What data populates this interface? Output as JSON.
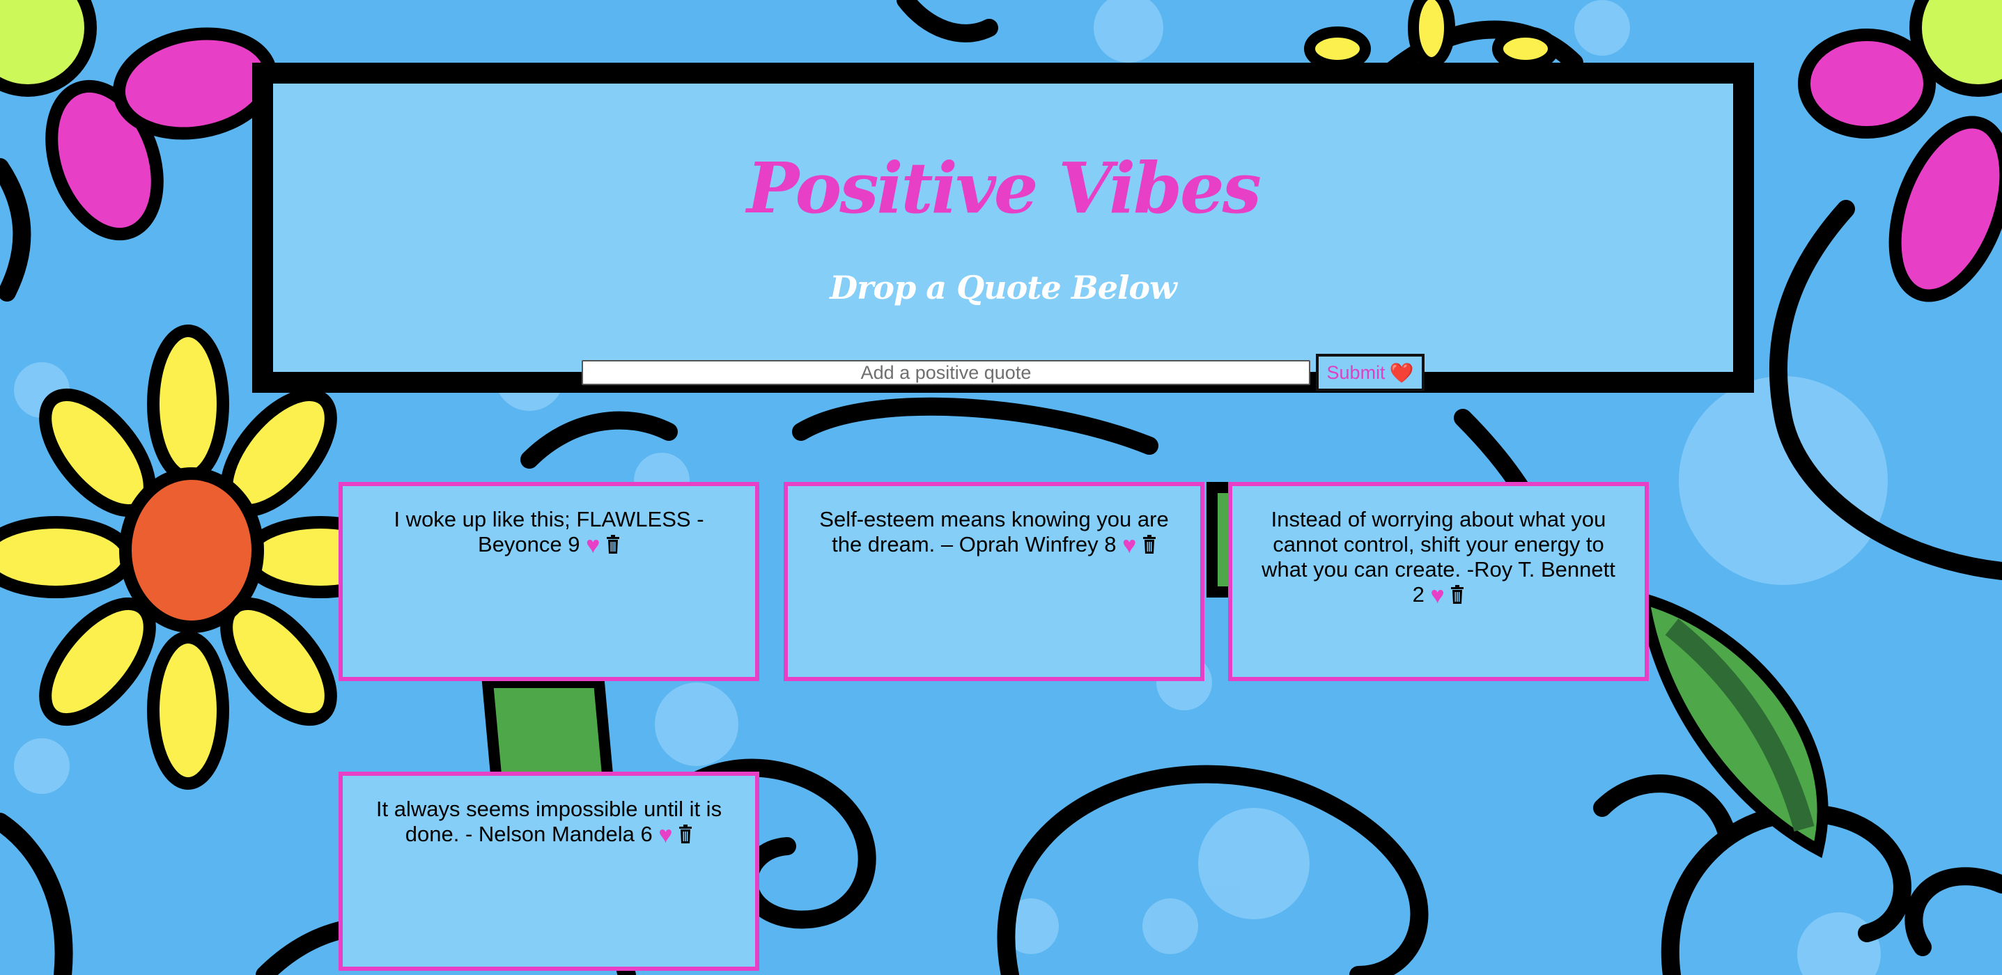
{
  "header": {
    "title": "Positive Vibes",
    "subtitle": "Drop a Quote Below"
  },
  "form": {
    "placeholder": "Add a positive quote",
    "value": "",
    "submit_label": "Submit",
    "submit_icon": "❤️"
  },
  "quotes": [
    {
      "text": "I woke up like this; FLAWLESS - Beyonce",
      "likes": "9"
    },
    {
      "text": "Self-esteem means knowing you are the dream. – Oprah Winfrey",
      "likes": "8"
    },
    {
      "text": "Instead of worrying about what you cannot control, shift your energy to what you can create. -Roy T. Bennett",
      "likes": "2"
    },
    {
      "text": "It always seems impossible until it is done. - Nelson Mandela",
      "likes": "6"
    }
  ],
  "icons": {
    "like": "heart-icon",
    "delete": "trash-icon"
  },
  "colors": {
    "accent_pink": "#e83fc7",
    "panel_blue": "#84cef8",
    "background_blue": "#5ab5f0"
  }
}
